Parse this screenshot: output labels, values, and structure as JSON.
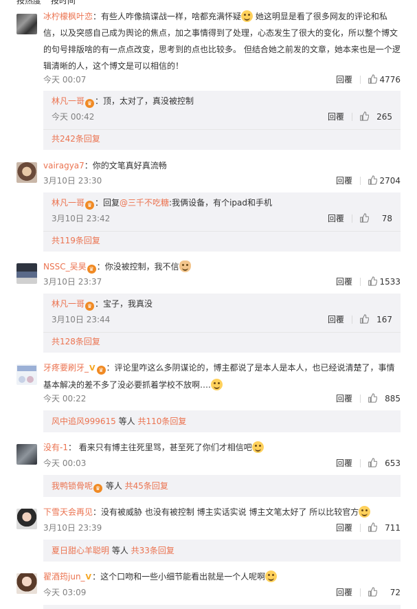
{
  "top_tabs": [
    "按热度",
    "按时间"
  ],
  "comments": [
    {
      "user": "冰柠檬枫叶恋",
      "text_a": "：有些人咋像搞谍战一样，啥都充满怀疑",
      "text_b": "她这明显是看了很多网友的评论和私信，以及突感自己成为舆论的焦点，加之事情得到了处理，心态发生了很大的变化，所以整个博文的句号排版啥的有一点点改变，思考到的点也比较多。 但结合她之前发的文章，她本来也是一个逻辑清晰的人，这个博文是可以相信的！",
      "time": "今天 00:07",
      "reply_label": "回覆",
      "likes": "4776",
      "sub": {
        "user": "林凡一哥",
        "text": "：顶，太对了，真没被控制",
        "time": "今天 00:42",
        "reply_label": "回覆",
        "likes": "265",
        "total": "共242条回复"
      }
    },
    {
      "user": "vairagya7",
      "text": "：你的文笔真好真流畅",
      "time": "3月10日 23:30",
      "reply_label": "回覆",
      "likes": "2704",
      "sub": {
        "user": "林凡一哥",
        "prefix": "：回复",
        "mention": "@三千不吃糖",
        "text": ":我俩设备，有个ipad和手机",
        "time": "3月10日 23:42",
        "reply_label": "回覆",
        "likes": "78",
        "total": "共119条回复"
      }
    },
    {
      "user": "NSSC_吴昊",
      "text": "：你没被控制，我不信",
      "time": "3月10日 23:37",
      "reply_label": "回覆",
      "likes": "1533",
      "sub": {
        "user": "林凡一哥",
        "text": "：宝子，我真没",
        "time": "3月10日 23:44",
        "reply_label": "回覆",
        "likes": "167",
        "total": "共128条回复"
      }
    },
    {
      "user": "牙疼要刷牙_",
      "text": "：评论里咋这么多阴谋论的，博主都说了是本人是本人，也已经说清楚了，事情基本解决的差不多了没必要抓着学校不放啊….",
      "time": "今天 00:22",
      "reply_label": "回覆",
      "likes": "885",
      "summary": {
        "user": "风中追风999615",
        "middle": " 等人 ",
        "total": "共110条回复"
      }
    },
    {
      "user": "没有-1",
      "text": "： 看来只有博主往死里骂，甚至死了你们才相信吧",
      "time": "今天 00:03",
      "reply_label": "回覆",
      "likes": "653",
      "summary": {
        "user": "我鸭锁骨呢",
        "middle": " 等人 ",
        "total": "共45条回复"
      }
    },
    {
      "user": "下雪天会再见",
      "text": "：没有被威胁 也没有被控制 博主实话实说 博主文笔太好了 所以比较官方",
      "time": "3月10日 23:39",
      "reply_label": "回覆",
      "likes": "711",
      "summary": {
        "user": "夏日甜心羊聪明",
        "middle": " 等人 ",
        "total": "共33条回复"
      }
    },
    {
      "user": "翟酒筠jun_",
      "text": "：这个口吻和一些小细节能看出就是一个人呢啊",
      "time": "今天 03:09",
      "reply_label": "回覆",
      "likes": "72"
    }
  ],
  "colors": {
    "accent": "#eb7350",
    "subbox_bg": "#f2f2f5",
    "meta_text": "#808080"
  },
  "icons": [
    "like-icon",
    "crown-badge-icon",
    "vip-v-icon",
    "emoji-icon"
  ]
}
